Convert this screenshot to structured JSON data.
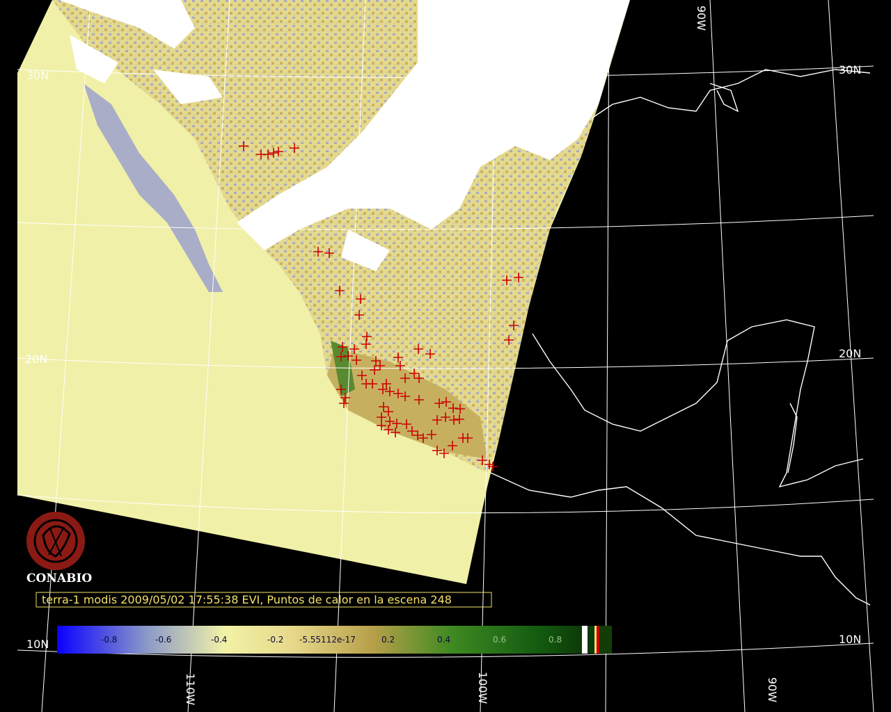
{
  "caption": "terra-1 modis 2009/05/02 17:55:38 EVI, Puntos de calor en la escena 248",
  "logo": {
    "text": "CONABIO",
    "icon": "conabio-logo-icon",
    "color": "#8b1a14"
  },
  "graticule": {
    "lat_labels": [
      "30N",
      "20N",
      "10N",
      "30N",
      "20N",
      "10N"
    ],
    "lon_labels": [
      "110W",
      "100W",
      "90W",
      "90W"
    ]
  },
  "colorbar": {
    "ticks": [
      "-0.8",
      "-0.6",
      "-0.4",
      "-0.2",
      "-5.55112e-17",
      "0.2",
      "0.4",
      "0.6",
      "0.8"
    ],
    "colors": [
      "#0a00ff",
      "#8a98c8",
      "#f2f2a6",
      "#c4a44a",
      "#1d6a12",
      "#123d08"
    ]
  },
  "hotspots": {
    "marker": "+",
    "color": "#cc0000",
    "count_label": "248"
  },
  "colors": {
    "background": "#000000",
    "swath": "#f0f0a8",
    "clouds": "#ffffff",
    "coastline": "#ffffff",
    "graticule": "#ffffff"
  }
}
